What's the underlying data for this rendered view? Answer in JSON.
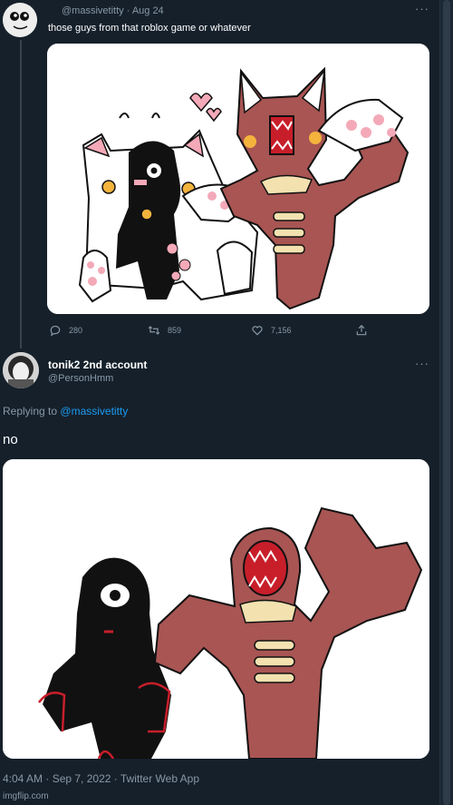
{
  "tweet1": {
    "handle": "@massivetitty",
    "date": "Aug 24",
    "separator": "·",
    "text": "those guys from that roblox game or whatever",
    "more": "···",
    "actions": {
      "replies": "280",
      "retweets": "859",
      "likes": "7,156"
    }
  },
  "tweet2": {
    "name": "tonik2 2nd account",
    "handle": "@PersonHmm",
    "more": "···",
    "replying_prefix": "Replying to",
    "replying_to": "@massivetitty",
    "text": "no",
    "timestamp": "4:04 AM · Sep 7, 2022 · Twitter Web App"
  },
  "watermark": "imgflip.com",
  "colors": {
    "background": "#15202b",
    "muted": "#8899a6",
    "link": "#1d9bf0",
    "maroon": "#a85553",
    "cream": "#f3e2b0",
    "pink": "#f4a9b8"
  },
  "icons": [
    "reply-icon",
    "retweet-icon",
    "like-icon",
    "share-icon"
  ]
}
